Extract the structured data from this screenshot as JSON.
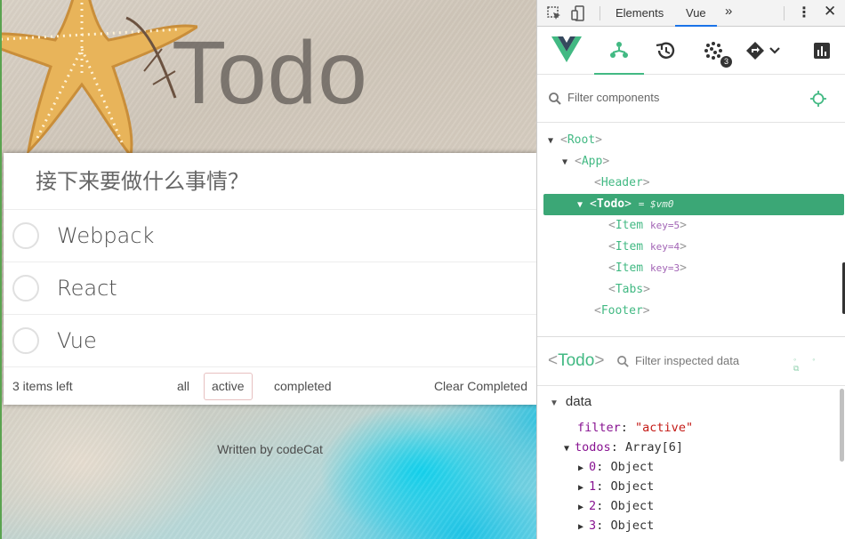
{
  "app": {
    "title": "Todo",
    "input_placeholder": "接下来要做什么事情？",
    "items": [
      {
        "text": "Webpack"
      },
      {
        "text": "React"
      },
      {
        "text": "Vue"
      }
    ],
    "footer": {
      "items_left": "3 items left",
      "tabs": [
        "all",
        "active",
        "completed"
      ],
      "selected_tab": "active",
      "clear": "Clear Completed"
    },
    "credit": "Written by codeCat"
  },
  "devtools": {
    "tabs": {
      "elements": "Elements",
      "vue": "Vue",
      "more": "»"
    },
    "toolbar": {
      "events_badge": "3"
    },
    "filter_components_placeholder": "Filter components",
    "tree": {
      "root": "Root",
      "app": "App",
      "header": "Header",
      "todo": "Todo",
      "todo_vm": "= $vm0",
      "items": [
        {
          "name": "Item",
          "key": "key=5"
        },
        {
          "name": "Item",
          "key": "key=4"
        },
        {
          "name": "Item",
          "key": "key=3"
        }
      ],
      "tabs": "Tabs",
      "footer": "Footer"
    },
    "inspector": {
      "component": "Todo",
      "filter_placeholder": "Filter inspected data",
      "section": "data",
      "filter_key": "filter",
      "filter_value": "\"active\"",
      "todos_key": "todos",
      "todos_value": "Array[6]",
      "todo_entries": [
        {
          "key": "0",
          "value": "Object"
        },
        {
          "key": "1",
          "value": "Object"
        },
        {
          "key": "2",
          "value": "Object"
        },
        {
          "key": "3",
          "value": "Object"
        }
      ]
    },
    "colors": {
      "vue_green": "#42b983",
      "selected_row": "#3ba776"
    }
  }
}
